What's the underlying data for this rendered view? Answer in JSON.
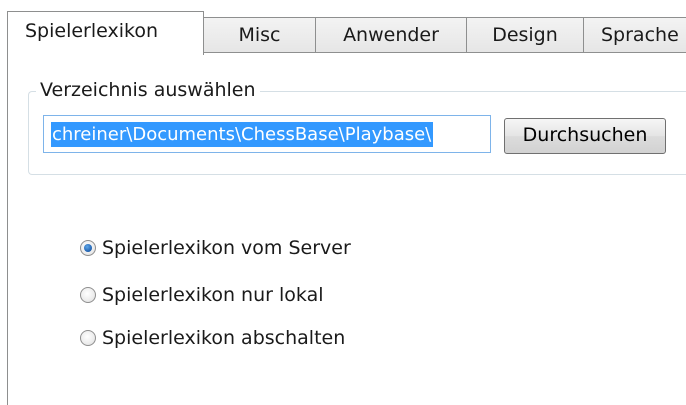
{
  "tabs": [
    {
      "label": "Spielerlexikon",
      "active": true
    },
    {
      "label": "Misc",
      "active": false
    },
    {
      "label": "Anwender",
      "active": false
    },
    {
      "label": "Design",
      "active": false
    },
    {
      "label": "Sprache",
      "active": false
    }
  ],
  "directory_group": {
    "title": "Verzeichnis auswählen",
    "path_value": "chreiner\\Documents\\ChessBase\\Playbase\\",
    "browse_label": "Durchsuchen"
  },
  "lexicon_mode": {
    "selected": "server",
    "options": [
      {
        "id": "server",
        "label": "Spielerlexikon vom Server"
      },
      {
        "id": "local",
        "label": "Spielerlexikon nur lokal"
      },
      {
        "id": "off",
        "label": "Spielerlexikon abschalten"
      }
    ]
  },
  "colors": {
    "selection_highlight": "#3399ff",
    "radio_checked": "#1f5fae",
    "tab_border": "#8e8f8f",
    "groupbox_border": "#d5dfe5"
  }
}
